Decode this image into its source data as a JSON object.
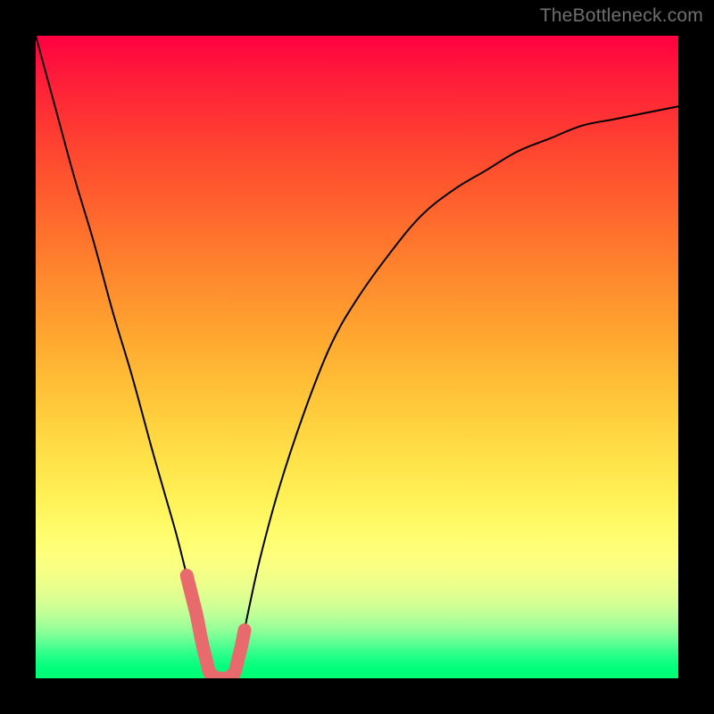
{
  "watermark": "TheBottleneck.com",
  "colors": {
    "frame": "#000000",
    "curve": "#000000",
    "marker": "#e96a6c",
    "gradient_top": "#ff0040",
    "gradient_bottom": "#00ff73"
  },
  "chart_data": {
    "type": "line",
    "title": "",
    "xlabel": "",
    "ylabel": "",
    "xlim": [
      0,
      100
    ],
    "ylim": [
      0,
      100
    ],
    "grid": false,
    "legend": false,
    "annotations": [
      "TheBottleneck.com"
    ],
    "series": [
      {
        "name": "bottleneck-curve",
        "x": [
          0,
          3,
          6,
          9,
          12,
          15,
          18,
          20,
          22,
          24,
          25,
          26,
          27,
          28,
          29,
          30,
          31,
          32,
          33,
          35,
          38,
          42,
          46,
          50,
          55,
          60,
          65,
          70,
          75,
          80,
          85,
          90,
          95,
          100
        ],
        "y": [
          100,
          89,
          78,
          68,
          57,
          47,
          36,
          29,
          22,
          14,
          10,
          5,
          1,
          0,
          0,
          0,
          1,
          5,
          10,
          19,
          30,
          42,
          52,
          59,
          66,
          72,
          76,
          79,
          82,
          84,
          86,
          87,
          88,
          89
        ]
      }
    ],
    "marker_band": {
      "name": "optimal-range",
      "x_start": 23.5,
      "x_end": 32.5,
      "description": "highlighted segment near curve minimum"
    }
  }
}
